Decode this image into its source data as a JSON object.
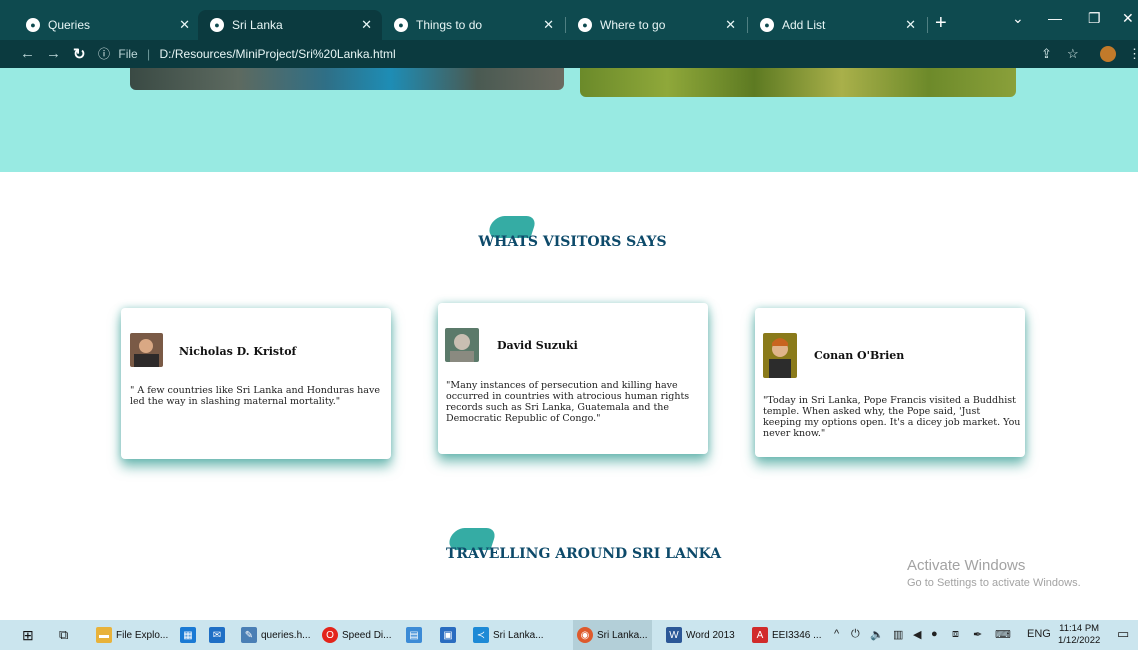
{
  "browser": {
    "tabs": [
      {
        "title": "Queries",
        "active": false
      },
      {
        "title": "Sri Lanka",
        "active": true
      },
      {
        "title": "Things to do",
        "active": false
      },
      {
        "title": "Where to go",
        "active": false
      },
      {
        "title": "Add List",
        "active": false
      }
    ],
    "address": {
      "scheme": "File",
      "path": "D:/Resources/MiniProject/Sri%20Lanka.html"
    }
  },
  "sections": {
    "visitors_title": "WHATS VISITORS SAYS",
    "travelling_title": "TRAVELLING AROUND SRI LANKA"
  },
  "testimonials": [
    {
      "name": "Nicholas D. Kristof",
      "quote": "\" A few countries like Sri Lanka and Honduras have led the way in slashing maternal mortality.\""
    },
    {
      "name": "David Suzuki",
      "quote": "\"Many instances of persecution and killing have occurred in countries with atrocious human rights records such as Sri Lanka, Guatemala and the Democratic Republic of Congo.\""
    },
    {
      "name": "Conan O'Brien",
      "quote": "\"Today in Sri Lanka, Pope Francis visited a Buddhist temple. When asked why, the Pope said, 'Just keeping my options open. It's a dicey job market. You never know.\""
    }
  ],
  "watermark": {
    "line1": "Activate Windows",
    "line2": "Go to Settings to activate Windows."
  },
  "taskbar": {
    "items": [
      {
        "label": "File Explo..."
      },
      {
        "label": "queries.h..."
      },
      {
        "label": "Speed Di..."
      },
      {
        "label": "Sri Lanka..."
      },
      {
        "label": "Sri Lanka..."
      },
      {
        "label": "Word 2013"
      },
      {
        "label": "EEI3346 ..."
      }
    ],
    "lang": "ENG",
    "time": "11:14 PM",
    "date": "1/12/2022"
  },
  "colors": {
    "hero_bg": "#98eae2",
    "chrome_bg": "#0e4a4f",
    "heading": "#0d4a6a",
    "leaf": "#1fa39a"
  }
}
